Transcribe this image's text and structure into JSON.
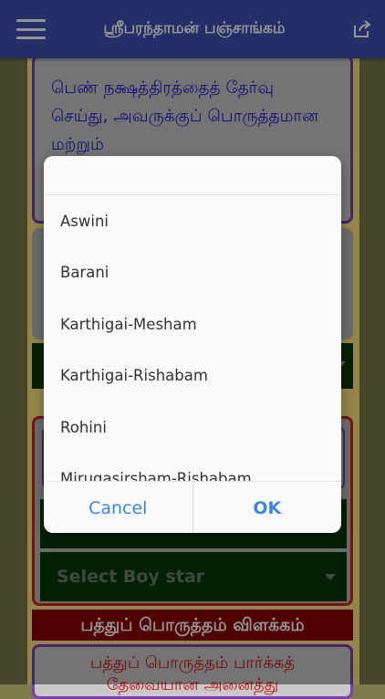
{
  "app": {
    "title": "ஸ்ரீபரந்தாமன் பஞ்சாங்கம்"
  },
  "intro_text": "பெண் நக்ஷத்திரத்தைத் தேர்வு செய்து, அவருக்குப் பொருத்தமான மற்றும்",
  "boy_select": {
    "placeholder": "Select Boy star"
  },
  "heading": "பத்துப் பொருத்தம் விளக்கம்",
  "bottom_text": "பத்துப் பொருத்தம் பார்க்கத் தேவையான அனைத்து",
  "dialog": {
    "items": [
      "Aswini",
      "Barani",
      "Karthigai-Mesham",
      "Karthigai-Rishabam",
      "Rohini",
      "Mirugasirsham-Rishabam"
    ],
    "cancel_label": "Cancel",
    "ok_label": "OK"
  },
  "colors": {
    "app_bar": "#3f51b5",
    "dialog_button": "#3b86e0",
    "heading_bar": "#8b0000",
    "select_bg": "#0a3a0a",
    "column_bg": "#ffe680"
  },
  "icons": {
    "menu": "hamburger-menu-icon",
    "share": "share-icon",
    "dropdown": "chevron-down-icon"
  }
}
